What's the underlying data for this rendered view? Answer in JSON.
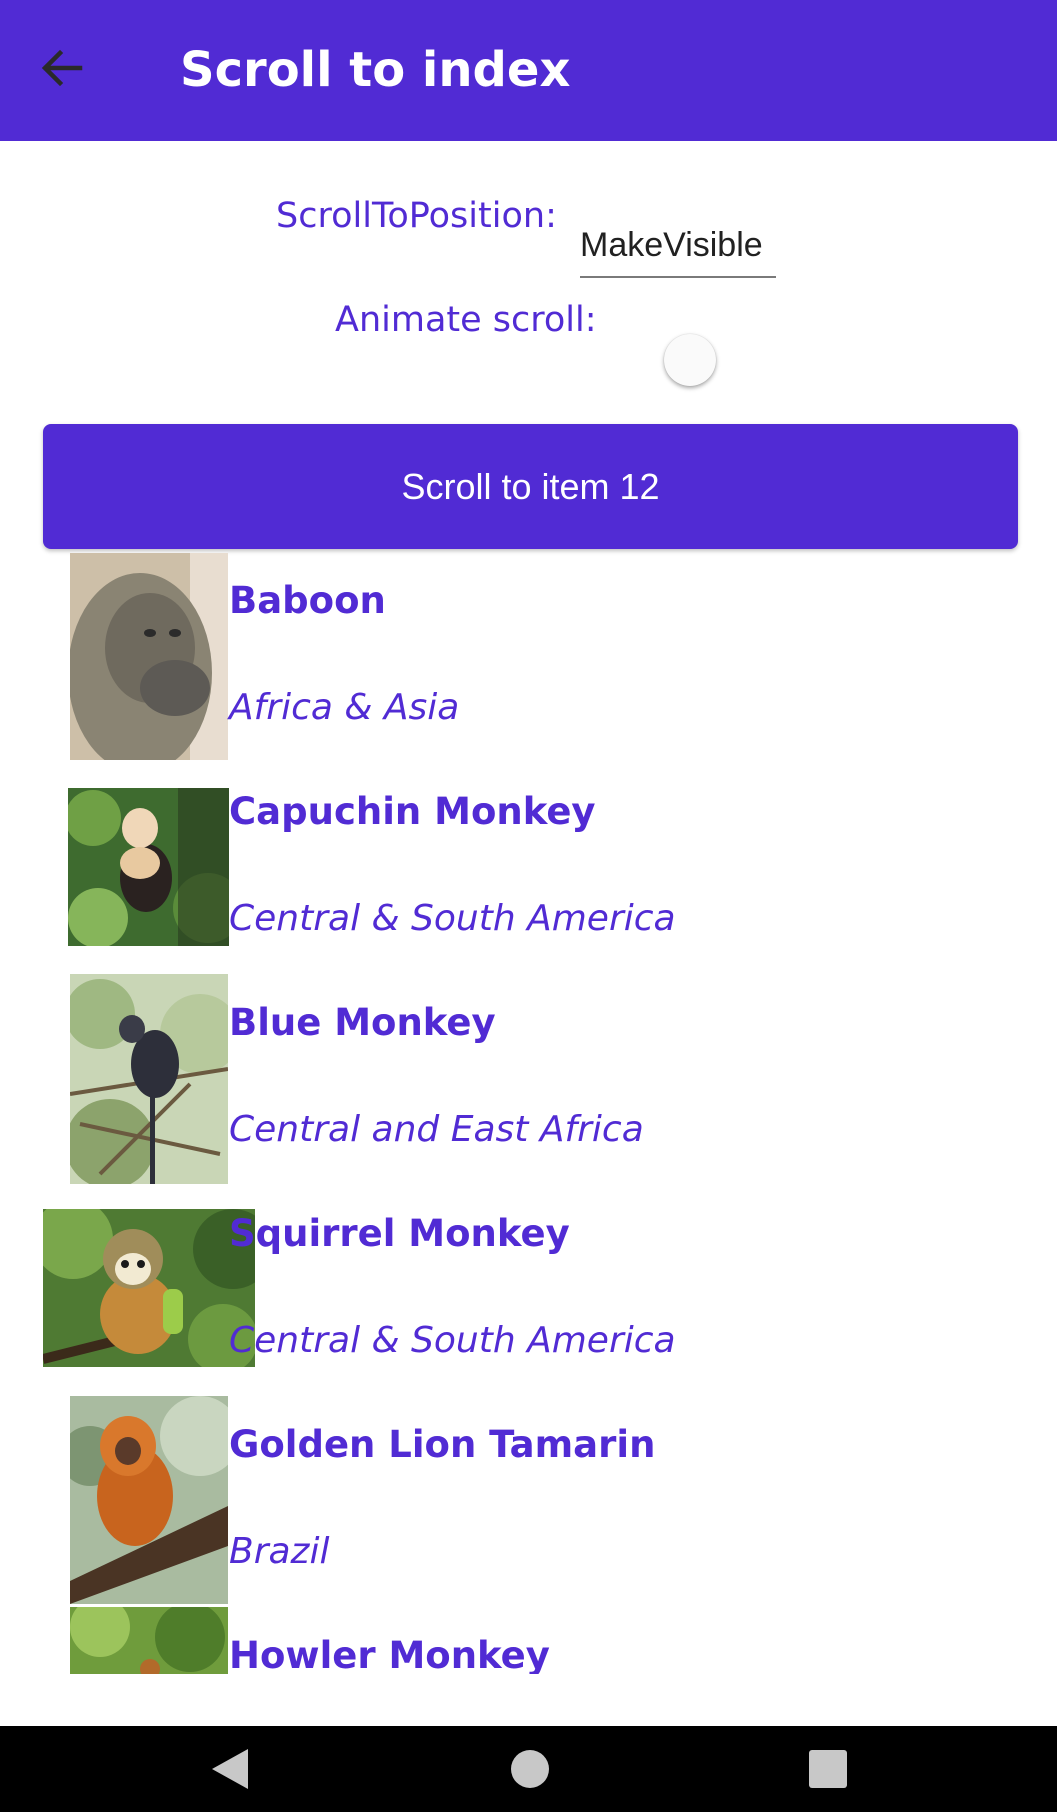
{
  "app_bar": {
    "title": "Scroll to index",
    "back_icon": "arrow-left-icon",
    "background": "#512BD4"
  },
  "form": {
    "scroll_to_position_label": "ScrollToPosition:",
    "scroll_to_position_value": "MakeVisible",
    "animate_scroll_label": "Animate scroll:",
    "animate_scroll_on": false
  },
  "scroll_button": {
    "label": "Scroll to item 12"
  },
  "list": {
    "items": [
      {
        "name": "Baboon",
        "location": "Africa & Asia"
      },
      {
        "name": "Capuchin Monkey",
        "location": "Central & South America"
      },
      {
        "name": "Blue Monkey",
        "location": "Central and East Africa"
      },
      {
        "name": "Squirrel Monkey",
        "location": "Central & South America"
      },
      {
        "name": "Golden Lion Tamarin",
        "location": "Brazil"
      },
      {
        "name": "Howler Monkey",
        "location": ""
      }
    ]
  },
  "nav_bar": {
    "back_icon": "triangle-back-icon",
    "home_icon": "circle-home-icon",
    "recents_icon": "square-recents-icon"
  },
  "colors": {
    "accent": "#512BD4",
    "nav_bar": "#000000"
  }
}
